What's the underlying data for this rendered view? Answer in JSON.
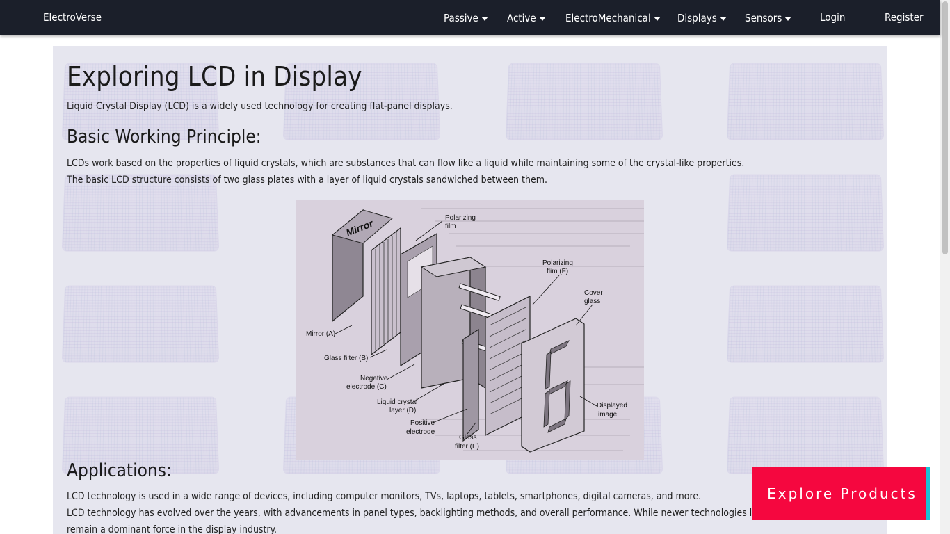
{
  "navbar": {
    "brand": "ElectroVerse",
    "items": [
      {
        "label": "Passive"
      },
      {
        "label": "Active"
      },
      {
        "label": "ElectroMechanical"
      },
      {
        "label": "Displays"
      },
      {
        "label": "Sensors"
      }
    ],
    "login": "Login",
    "register": "Register"
  },
  "article": {
    "title": "Exploring LCD in Display",
    "intro": "Liquid Crystal Display (LCD) is a widely used technology for creating flat-panel displays.",
    "principle_heading": "Basic Working Principle:",
    "principle_p1": "LCDs work based on the properties of liquid crystals, which are substances that can flow like a liquid while maintaining some of the crystal-like properties.",
    "principle_p2": "The basic LCD structure consists of two glass plates with a layer of liquid crystals sandwiched between them.",
    "applications_heading": "Applications:",
    "applications_p1": "LCD technology is used in a wide range of devices, including computer monitors, TVs, laptops, tablets, smartphones, digital cameras, and more.",
    "applications_p2": "LCD technology has evolved over the years, with advancements in panel types, backlighting methods, and overall performance. While newer technologies like OLED are ga",
    "applications_p3": "remain a dominant force in the display industry."
  },
  "diagram": {
    "mirror_word": "Mirror",
    "labels": {
      "polarizing_film": "Polarizing",
      "polarizing_film_2": "film",
      "polarizing_f": "Polarizing",
      "polarizing_f_2": "flim (F)",
      "cover_glass": "Cover",
      "cover_glass_2": "glass",
      "mirror_a": "Mirror (A)",
      "glass_filter_b": "Glass filter (B)",
      "negative_electrode": "Negative",
      "negative_electrode_2": "electrode (C)",
      "lc_layer": "Liquid crystal",
      "lc_layer_2": "layer (D)",
      "positive_electrode": "Positive",
      "positive_electrode_2": "electrode",
      "glass_filter_e": "Glass",
      "glass_filter_e_2": "filter (E)",
      "displayed_image": "Displayed",
      "displayed_image_2": "image"
    }
  },
  "cta": {
    "explore": "Explore Products"
  },
  "colors": {
    "navbar": "#1b1f2a",
    "cta": "#f5073f",
    "cta_shadow": "#19c1d6"
  }
}
